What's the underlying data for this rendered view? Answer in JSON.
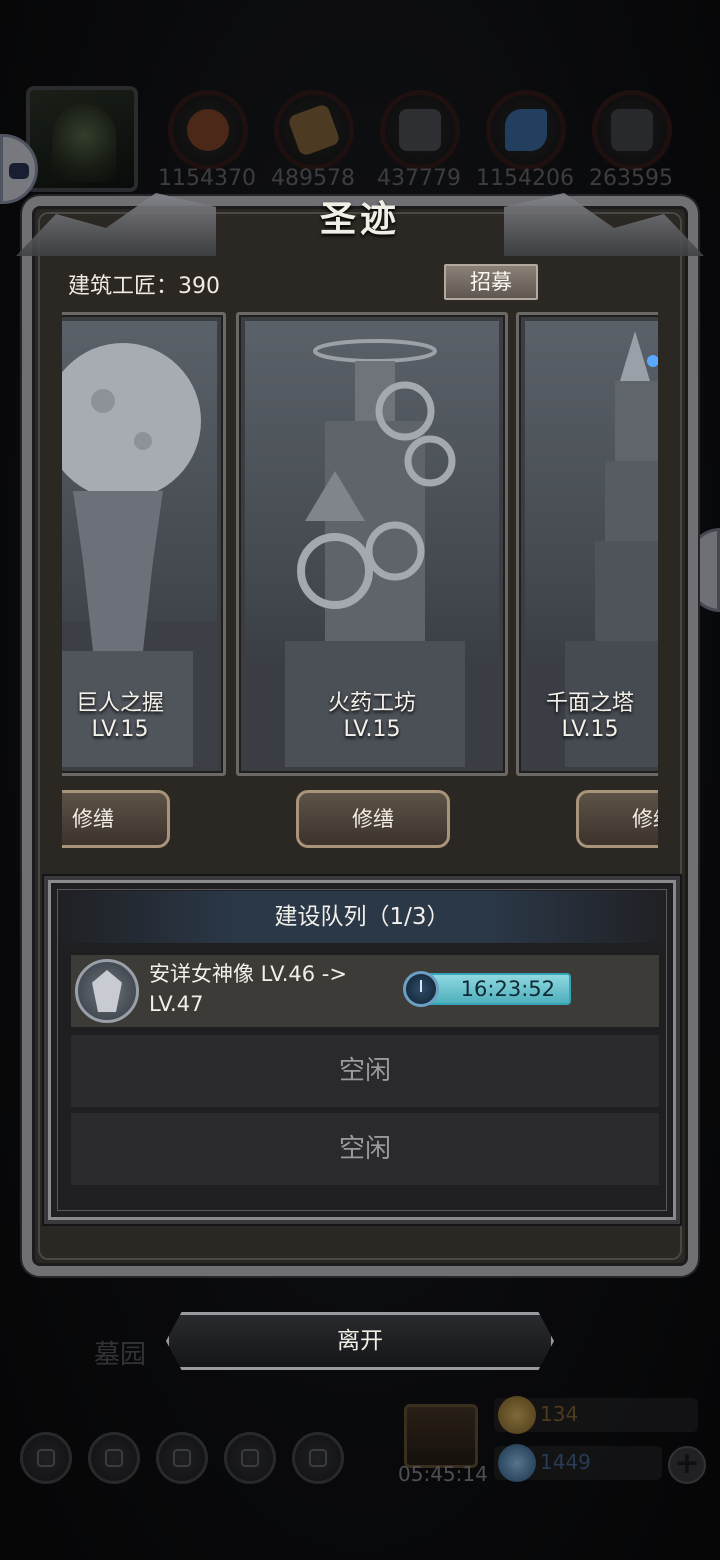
{
  "hud": {
    "resources": [
      {
        "icon": "meat-icon",
        "value": "1154370",
        "color": "#8a4a2e"
      },
      {
        "icon": "wood-icon",
        "value": "489578",
        "color": "#8a6a3e"
      },
      {
        "icon": "stone-icon",
        "value": "437779",
        "color": "#55575c"
      },
      {
        "icon": "crystal-icon",
        "value": "1154206",
        "color": "#3f74b0"
      },
      {
        "icon": "iron-icon",
        "value": "263595",
        "color": "#4a4b50"
      }
    ],
    "location_label": "墓园",
    "gift_timer": "05:45:14",
    "gold": "134",
    "gems": "1449",
    "plus": "+"
  },
  "dialog": {
    "title": "圣迹",
    "builder_label": "建筑工匠：390",
    "recruit_label": "招募",
    "buildings": [
      {
        "name": "巨人之握",
        "level": "LV.15",
        "action": "修缮"
      },
      {
        "name": "火药工坊",
        "level": "LV.15",
        "action": "修缮"
      },
      {
        "name": "千面之塔",
        "level": "LV.15",
        "action": "修缮"
      }
    ],
    "queue": {
      "title": "建设队列（1/3）",
      "active": {
        "text": "安详女神像 LV.46 -> LV.47",
        "timer": "16:23:52"
      },
      "idle_label_1": "空闲",
      "idle_label_2": "空闲"
    },
    "leave_label": "离开"
  }
}
